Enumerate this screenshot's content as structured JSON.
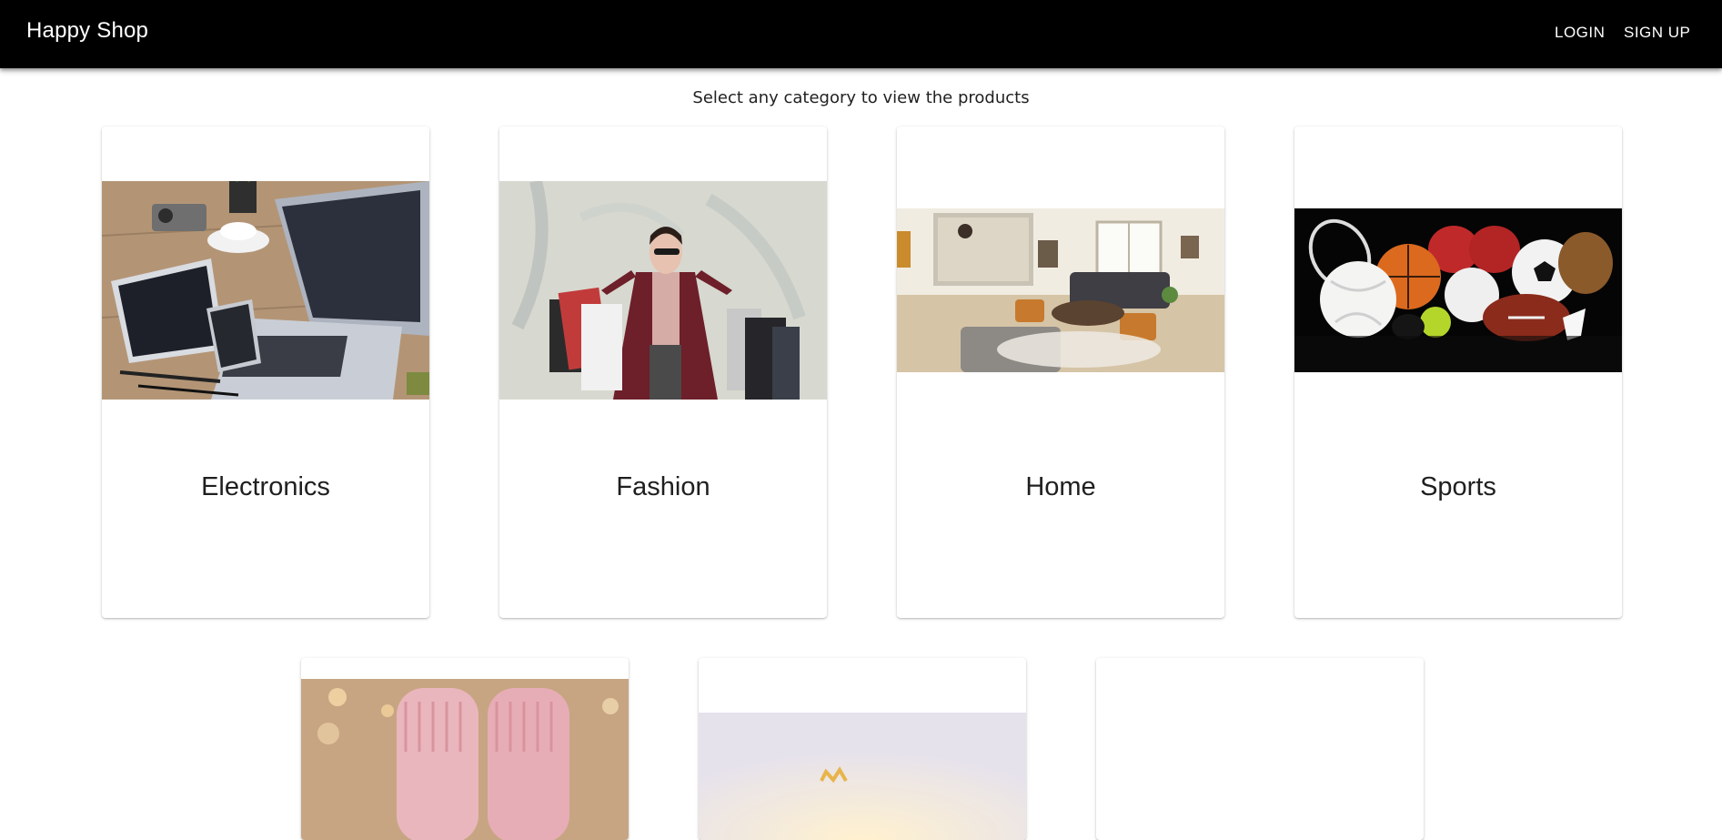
{
  "header": {
    "brand": "Happy Shop",
    "login_label": "LOGIN",
    "signup_label": "SIGN UP"
  },
  "main": {
    "subtitle": "Select any category to view the products",
    "categories": [
      {
        "label": "Electronics",
        "image": "laptop-tablet-phone-desk-photo"
      },
      {
        "label": "Fashion",
        "image": "woman-shopping-bags-photo"
      },
      {
        "label": "Home",
        "image": "living-room-interior-photo"
      },
      {
        "label": "Sports",
        "image": "sports-balls-photo"
      },
      {
        "label": "",
        "image": "pink-baby-booties-photo"
      },
      {
        "label": "",
        "image": "soft-light-photo"
      },
      {
        "label": "",
        "image": ""
      }
    ]
  },
  "colors": {
    "appbar": "#000000",
    "page_background": "#ffffff",
    "text": "#1f1f1f"
  }
}
